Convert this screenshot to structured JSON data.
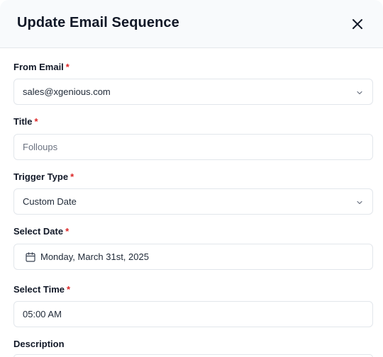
{
  "modal": {
    "title": "Update Email Sequence"
  },
  "form": {
    "from_email": {
      "label": "From Email",
      "required_mark": "*",
      "value": "sales@xgenious.com"
    },
    "title": {
      "label": "Title",
      "required_mark": "*",
      "value": "Folloups"
    },
    "trigger_type": {
      "label": "Trigger Type",
      "required_mark": "*",
      "value": "Custom Date"
    },
    "select_date": {
      "label": "Select Date",
      "required_mark": "*",
      "value": "Monday, March 31st, 2025"
    },
    "select_time": {
      "label": "Select Time",
      "required_mark": "*",
      "value": "05:00 AM"
    },
    "description": {
      "label": "Description"
    }
  },
  "icons": {
    "close": "close-icon",
    "chevron": "chevron-down-icon",
    "calendar": "calendar-icon"
  },
  "colors": {
    "required": "#dc2626",
    "header_bg": "#f8fafc",
    "border": "#e2e6eb"
  }
}
